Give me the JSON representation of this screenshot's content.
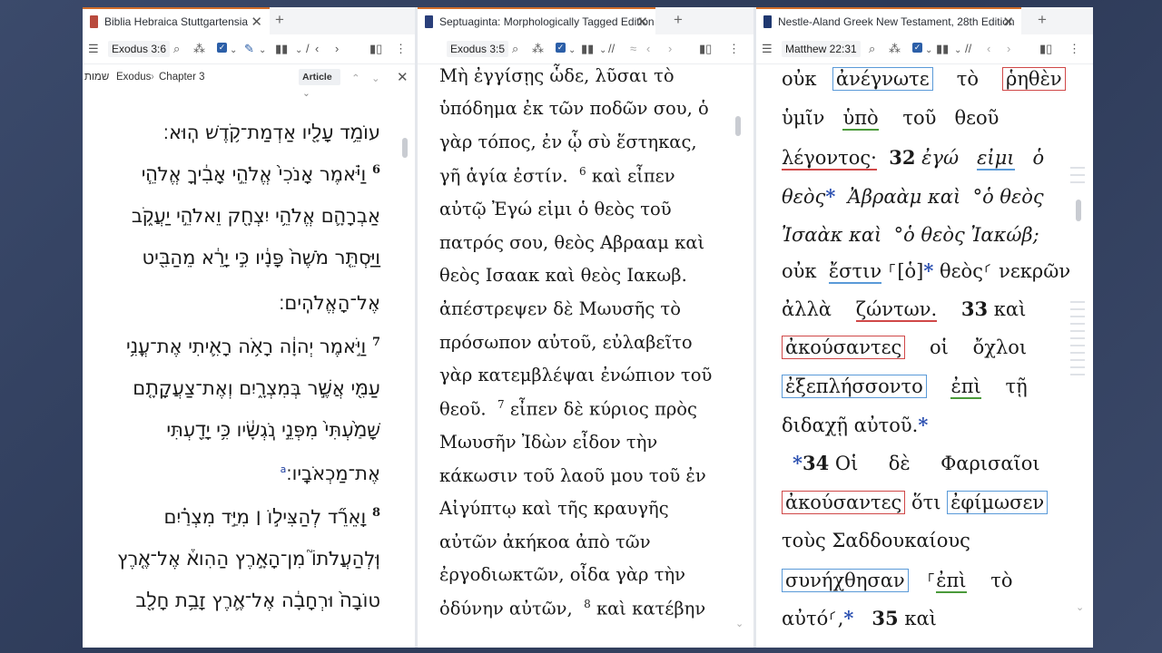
{
  "colors": {
    "tab_accent": "#d36f2a",
    "check_blue": "#2c5fa8",
    "blue_mark": "#5a9ad8",
    "red_mark": "#d04848",
    "green_mark": "#4a9a3a"
  },
  "pane1": {
    "tab_title": "Biblia Hebraica Stuttgartensia",
    "book_color": "#b94a3d",
    "reference": "Exodus 3:6",
    "breadcrumb": {
      "hebrew": "שמות",
      "book": "Exodus",
      "separator": "›",
      "chapter": "Chapter 3",
      "article": "Article"
    },
    "lines": [
      "עוֹמֵ֥ד עָלָ֖יו אַדְמַת־קֹ֥דֶשׁ הֽוּא׃",
      "וַיֹּ֗אמֶר אָנֹכִי֙ אֱלֹהֵ֣י אָבִ֔יךָ אֱלֹהֵ֧י",
      "אַבְרָהָ֛ם אֱלֹהֵ֥י יִצְחָ֖ק וֵאלֹהֵ֣י יַעֲקֹ֑ב",
      "וַיַּסְתֵּ֤ר מֹשֶׁה֙ פָּנָ֔יו כִּ֣י יָרֵ֔א מֵהַבִּ֖יט",
      "אֶל־הָאֱלֹהִֽים׃",
      "וַיֹּ֣אמֶר יְהוָ֔ה רָאֹ֥ה רָאִ֛יתִי אֶת־עֳנִ֥י",
      "עַמִּ֖י אֲשֶׁ֣ר בְּמִצְרָ֑יִם וְאֶת־צַעֲקָתָ֤ם",
      "שָׁמַ֙עְתִּי֙ מִפְּנֵ֣י נֹֽגְשָׂ֔יו כִּ֥י יָדַ֖עְתִּי",
      "אֶת־מַכְאֹבָֽיו׃",
      "וָאֵרֵ֞ד לְהַצִּיל֣וֹ ׀ מִיַּ֣ד מִצְרַ֗יִם",
      "וּֽלְהַעֲלֹתוֹ֮ מִן־הָאָ֣רֶץ הַהִוא֒ אֶל־אֶ֤רֶץ",
      "טוֹבָה֙ וּרְחָבָ֔ה אֶל־אֶ֛רֶץ זָבַ֥ת חָלָ֖ב"
    ],
    "verse_nums": {
      "v6": "6",
      "v7": "7",
      "v8": "8"
    },
    "footnotes": {
      "a": "a",
      "b": "b"
    }
  },
  "pane2": {
    "tab_title": "Septuaginta: Morphologically Tagged Edition",
    "book_color": "#2a3f7a",
    "reference": "Exodus 3:5",
    "lines": [
      "Μὴ ἐγγίσῃς ὧδε, λῦσαι τὸ",
      "ὑπόδημα ἐκ τῶν ποδῶν σου, ὁ",
      "γὰρ τόπος, ἐν ᾧ σὺ ἕστηκας,",
      "γῆ ἁγία ἐστίν.",
      "αὐτῷ Ἐγώ εἰμι ὁ θεὸς τοῦ",
      "πατρός σου, θεὸς Αβρααμ καὶ",
      "θεὸς Ισαακ καὶ θεὸς Ιακωβ.",
      "ἀπέστρεψεν δὲ Μωυσῆς τὸ",
      "πρόσωπον αὐτοῦ, εὐλαβεῖτο",
      "γὰρ κατεμβλέψαι ἐνώπιον τοῦ",
      "θεοῦ.",
      "Μωυσῆν Ἰδὼν εἶδον τὴν",
      "κάκωσιν τοῦ λαοῦ μου τοῦ ἐν",
      "Αἰγύπτῳ καὶ τῆς κραυγῆς",
      "αὐτῶν ἀκήκοα ἀπὸ τῶν",
      "ἐργοδιωκτῶν, οἶδα γὰρ τὴν",
      "ὀδύνην αὐτῶν,"
    ],
    "inline": {
      "v6": "6",
      "v6_text": "καὶ εἶπεν",
      "v7": "7",
      "v7_text": "εἶπεν δὲ κύριος πρὸς",
      "v8": "8",
      "v8_text": "καὶ κατέβην"
    }
  },
  "pane3": {
    "tab_title": "Nestle-Aland Greek New Testament, 28th Edition",
    "book_color": "#1f3870",
    "reference": "Matthew 22:31",
    "w": {
      "oyk": "οὐκ",
      "anegnote": "ἀνέγνωτε",
      "to": "τὸ",
      "rhethen": "ῥηθὲν",
      "hymin": "ὑμῖν",
      "hypo": "ὑπὸ",
      "tou": "τοῦ",
      "theou": "θεοῦ",
      "legontos": "λέγοντος·",
      "v32": "32",
      "ego": "ἐγώ",
      "eimi": "εἰμι",
      "ho": "ὁ",
      "theos": "θεὸς",
      "abraam": "Ἀβραὰμ καὶ",
      "ho_theos": "ὁ θεὸς",
      "isaak": "Ἰσαὰκ καὶ",
      "ho_theos_iakob": "ὁ θεὸς Ἰακώβ;",
      "oyk2": "οὐκ",
      "estin": "ἔστιν",
      "ho_br": "[ὁ]",
      "theos2": "θεὸς",
      "nekron": "νεκρῶν",
      "alla": "ἀλλὰ",
      "zonton": "ζώντων.",
      "v33": "33",
      "kai": "καὶ",
      "akousantes": "ἀκούσαντες",
      "hoi": "οἱ",
      "ochloi": "ὄχλοι",
      "exeplessonto": "ἐξεπλήσσοντο",
      "epi": "ἐπὶ",
      "te": "τῇ",
      "didache": "διδαχῇ αὐτοῦ.",
      "v34": "34",
      "hoi2": "Οἱ",
      "de": "δὲ",
      "pharisaioi": "Φαρισαῖοι",
      "akousantes2": "ἀκούσαντες",
      "hoti": "ὅτι",
      "ephimosen": "ἐφίμωσεν",
      "tous": "τοὺς Σαδδουκαίους",
      "synechthesan": "συνήχθησαν",
      "epi2": "ἐπὶ",
      "to2": "τὸ",
      "auto": "αὐτό",
      "v35": "35",
      "kai2": "καὶ",
      "asterisk": "*",
      "circle": "°",
      "open_mark": "⸀",
      "close_mark": "⸂"
    }
  }
}
